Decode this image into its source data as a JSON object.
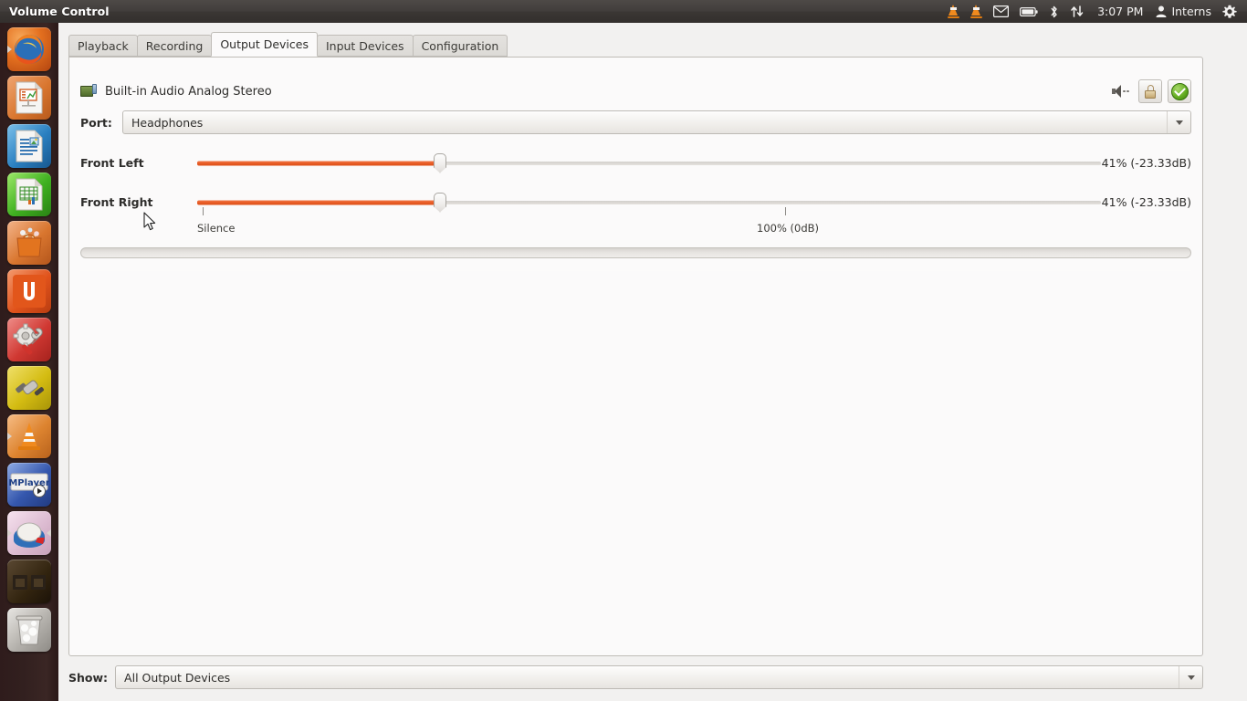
{
  "panel": {
    "title": "Volume Control",
    "tray": {
      "icons": [
        "vlc-cone-icon",
        "vlc-cone-icon",
        "mail-envelope-icon",
        "battery-icon",
        "bluetooth-icon",
        "network-updown-icon"
      ],
      "clock": "3:07 PM",
      "user": "Interns",
      "gear": "⚙"
    }
  },
  "launcher": {
    "items": [
      {
        "name": "firefox",
        "glyph": "",
        "bg1": "#f09a4a",
        "bg2": "#d15a18",
        "running": true
      },
      {
        "name": "libreoffice-impress",
        "glyph": "",
        "bg1": "#e8a070",
        "bg2": "#c05f23",
        "running": false
      },
      {
        "name": "libreoffice-writer",
        "glyph": "",
        "bg1": "#6fb3e0",
        "bg2": "#1a6fae",
        "running": false
      },
      {
        "name": "libreoffice-calc",
        "glyph": "",
        "bg1": "#7fd44a",
        "bg2": "#2f9312",
        "running": false
      },
      {
        "name": "ubuntu-software-center",
        "glyph": "",
        "bg1": "#f0a070",
        "bg2": "#d4601e",
        "running": false
      },
      {
        "name": "ubuntu-one",
        "glyph": "U",
        "bg1": "#f07b45",
        "bg2": "#d4450f",
        "running": false
      },
      {
        "name": "system-settings",
        "glyph": "",
        "bg1": "#e86a66",
        "bg2": "#c02a26",
        "running": false
      },
      {
        "name": "hardware-tool",
        "glyph": "",
        "bg1": "#e8d44a",
        "bg2": "#c4a70c",
        "running": false
      },
      {
        "name": "vlc-media-player",
        "glyph": "",
        "bg1": "#f0a860",
        "bg2": "#d4761c",
        "running": true
      },
      {
        "name": "mplayer",
        "glyph": "MPlayer",
        "bg1": "#6d8fd8",
        "bg2": "#2c4d9e",
        "running": false
      },
      {
        "name": "volume-control",
        "glyph": "",
        "bg1": "#efd9e6",
        "bg2": "#d8b8cc",
        "running": true
      },
      {
        "name": "workspace-switcher",
        "glyph": "",
        "bg1": "#4a3a28",
        "bg2": "#241a10",
        "running": false
      },
      {
        "name": "trash",
        "glyph": "",
        "bg1": "#d8d6d2",
        "bg2": "#9c9a96",
        "running": false
      }
    ]
  },
  "tabs": [
    {
      "label": "Playback",
      "active": false
    },
    {
      "label": "Recording",
      "active": false
    },
    {
      "label": "Output Devices",
      "active": true
    },
    {
      "label": "Input Devices",
      "active": false
    },
    {
      "label": "Configuration",
      "active": false
    }
  ],
  "device": {
    "name": "Built-in Audio Analog Stereo",
    "icon": "sound-card-icon",
    "mute_icon": "speaker-icon",
    "lock_icon": "lock-icon",
    "default_icon": "check-circle-icon",
    "port_label": "Port:",
    "port_value": "Headphones",
    "channels": [
      {
        "label": "Front Left",
        "value_text": "41% (-23.33dB)",
        "percent": 41
      },
      {
        "label": "Front Right",
        "value_text": "41% (-23.33dB)",
        "percent": 41
      }
    ],
    "marks": [
      {
        "text": "Silence",
        "percent": 0
      },
      {
        "text": "100% (0dB)",
        "percent": 65
      }
    ]
  },
  "footer": {
    "show_label": "Show:",
    "show_value": "All Output Devices"
  },
  "colors": {
    "slider_fill": "#e85b25",
    "panel_bg": "#3b3734",
    "window_bg": "#f2f1f0",
    "content_bg": "#fbfafa"
  }
}
